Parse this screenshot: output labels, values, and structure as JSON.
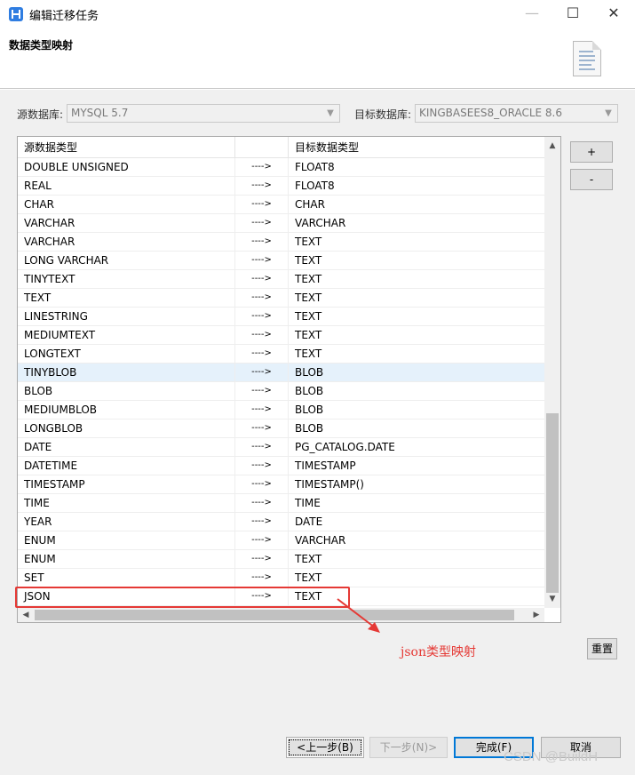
{
  "window": {
    "title": "编辑迁移任务",
    "min": "—",
    "max": "☐",
    "close": "✕"
  },
  "header": {
    "title": "数据类型映射"
  },
  "source": {
    "label": "源数据库:",
    "value": "MYSQL 5.7"
  },
  "target": {
    "label": "目标数据库:",
    "value": "KINGBASEES8_ORACLE 8.6"
  },
  "table": {
    "columns": [
      "源数据类型",
      "",
      "目标数据类型"
    ],
    "rows": [
      [
        "DOUBLE UNSIGNED",
        "---->",
        "FLOAT8"
      ],
      [
        "REAL",
        "---->",
        "FLOAT8"
      ],
      [
        "CHAR",
        "---->",
        "CHAR"
      ],
      [
        "VARCHAR",
        "---->",
        "VARCHAR"
      ],
      [
        "VARCHAR",
        "---->",
        "TEXT"
      ],
      [
        "LONG VARCHAR",
        "---->",
        "TEXT"
      ],
      [
        "TINYTEXT",
        "---->",
        "TEXT"
      ],
      [
        "TEXT",
        "---->",
        "TEXT"
      ],
      [
        "LINESTRING",
        "---->",
        "TEXT"
      ],
      [
        "MEDIUMTEXT",
        "---->",
        "TEXT"
      ],
      [
        "LONGTEXT",
        "---->",
        "TEXT"
      ],
      [
        "TINYBLOB",
        "---->",
        "BLOB"
      ],
      [
        "BLOB",
        "---->",
        "BLOB"
      ],
      [
        "MEDIUMBLOB",
        "---->",
        "BLOB"
      ],
      [
        "LONGBLOB",
        "---->",
        "BLOB"
      ],
      [
        "DATE",
        "---->",
        "PG_CATALOG.DATE"
      ],
      [
        "DATETIME",
        "---->",
        "TIMESTAMP"
      ],
      [
        "TIMESTAMP",
        "---->",
        "TIMESTAMP()"
      ],
      [
        "TIME",
        "---->",
        "TIME"
      ],
      [
        "YEAR",
        "---->",
        "DATE"
      ],
      [
        "ENUM",
        "---->",
        "VARCHAR"
      ],
      [
        "ENUM",
        "---->",
        "TEXT"
      ],
      [
        "SET",
        "---->",
        "TEXT"
      ],
      [
        "JSON",
        "---->",
        "TEXT"
      ]
    ],
    "selected_row": 11
  },
  "side_buttons": {
    "add": "+",
    "remove": "-",
    "reset": "重置"
  },
  "annotation": {
    "text": "json类型映射",
    "color": "#e53935"
  },
  "footer": {
    "prev": "<上一步(B)",
    "next": "下一步(N)>",
    "finish": "完成(F)",
    "cancel": "取消"
  },
  "watermark": "CSDN @BuildH",
  "icons": {
    "app": "app-logo-icon",
    "doc": "document-icon",
    "dropdown": "chevron-down-icon"
  }
}
